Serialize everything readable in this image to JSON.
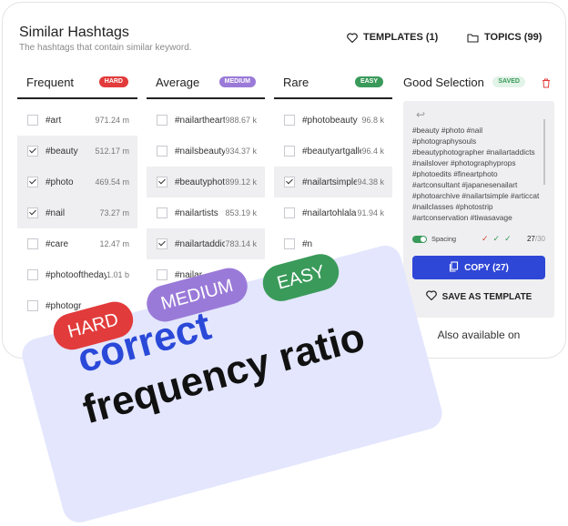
{
  "header": {
    "title": "Similar Hashtags",
    "subtitle": "The hashtags that contain similar keyword.",
    "templates_label": "TEMPLATES (1)",
    "topics_label": "TOPICS (99)"
  },
  "columns": [
    {
      "name": "Frequent",
      "badge": "HARD",
      "badge_color": "#e23b3b",
      "rows": [
        {
          "tag": "#art",
          "count": "971.24 m",
          "selected": false
        },
        {
          "tag": "#beauty",
          "count": "512.17 m",
          "selected": true
        },
        {
          "tag": "#photo",
          "count": "469.54 m",
          "selected": true
        },
        {
          "tag": "#nail",
          "count": "73.27 m",
          "selected": true
        },
        {
          "tag": "#care",
          "count": "12.47 m",
          "selected": false
        },
        {
          "tag": "#photooftheday",
          "count": "1.01 b",
          "selected": false
        },
        {
          "tag": "#photogr",
          "count": "",
          "selected": false
        }
      ]
    },
    {
      "name": "Average",
      "badge": "MEDIUM",
      "badge_color": "#9a7ad8",
      "rows": [
        {
          "tag": "#nailarthearts",
          "count": "988.67 k",
          "selected": false
        },
        {
          "tag": "#nailsbeauty",
          "count": "934.37 k",
          "selected": false
        },
        {
          "tag": "#beautyphotography",
          "count": "899.12 k",
          "selected": true
        },
        {
          "tag": "#nailartists",
          "count": "853.19 k",
          "selected": false
        },
        {
          "tag": "#nailartaddicts",
          "count": "783.14 k",
          "selected": true
        },
        {
          "tag": "#nailar",
          "count": "",
          "selected": false
        }
      ]
    },
    {
      "name": "Rare",
      "badge": "EASY",
      "badge_color": "#3a9a5a",
      "rows": [
        {
          "tag": "#photobeauty",
          "count": "96.8 k",
          "selected": false
        },
        {
          "tag": "#beautyartgallery",
          "count": "96.4 k",
          "selected": false
        },
        {
          "tag": "#nailartsimple",
          "count": "94.38 k",
          "selected": true
        },
        {
          "tag": "#nailartohlala",
          "count": "91.94 k",
          "selected": false
        },
        {
          "tag": "#n",
          "count": "",
          "selected": false
        }
      ]
    }
  ],
  "good_selection": {
    "title": "Good Selection",
    "badge": "SAVED",
    "tags_text": [
      "#beauty #photo #nail",
      "#photographysouls",
      "#beautyphotographer #nailartaddicts",
      "#nailslover #photographyprops",
      "#photoedits #fineartphoto",
      "#artconsultant #japanesenailart",
      "#photoarchive #nailartsimple #articcat",
      "#nailclasses #photostrip",
      "#artconservation #tiwasavage"
    ],
    "spacing_label": "Spacing",
    "count": "27",
    "count_total": "/30",
    "copy_label": "COPY (27)",
    "save_template_label": "SAVE AS TEMPLATE",
    "available_label": "Also available on"
  },
  "promo": {
    "pills": [
      "HARD",
      "MEDIUM",
      "EASY"
    ],
    "line1": "correct",
    "line2": "frequency ratio"
  }
}
